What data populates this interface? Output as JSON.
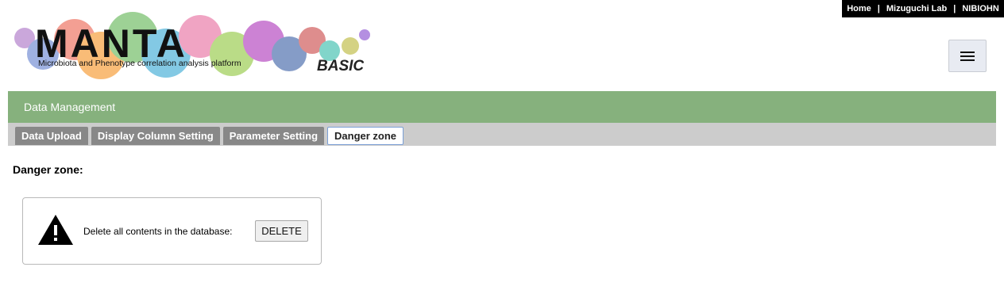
{
  "topnav": {
    "home": "Home",
    "lab": "Mizuguchi Lab",
    "org": "NIBIOHN",
    "separator": "|"
  },
  "logo": {
    "title": "MANTA",
    "subtitle": "Microbiota and Phenotype correlation analysis platform",
    "edition": "BASIC"
  },
  "section": {
    "title": "Data Management"
  },
  "tabs": [
    {
      "label": "Data Upload",
      "active": false
    },
    {
      "label": "Display Column Setting",
      "active": false
    },
    {
      "label": "Parameter Setting",
      "active": false
    },
    {
      "label": "Danger zone",
      "active": true
    }
  ],
  "danger": {
    "heading": "Danger zone:",
    "message": "Delete all contents in the database:",
    "button_label": "DELETE",
    "icon": "warning-icon"
  },
  "colors": {
    "section_bar": "#86b17d",
    "tab_bar": "#cccccc",
    "tab_inactive": "#888888",
    "topbar": "#000000"
  }
}
